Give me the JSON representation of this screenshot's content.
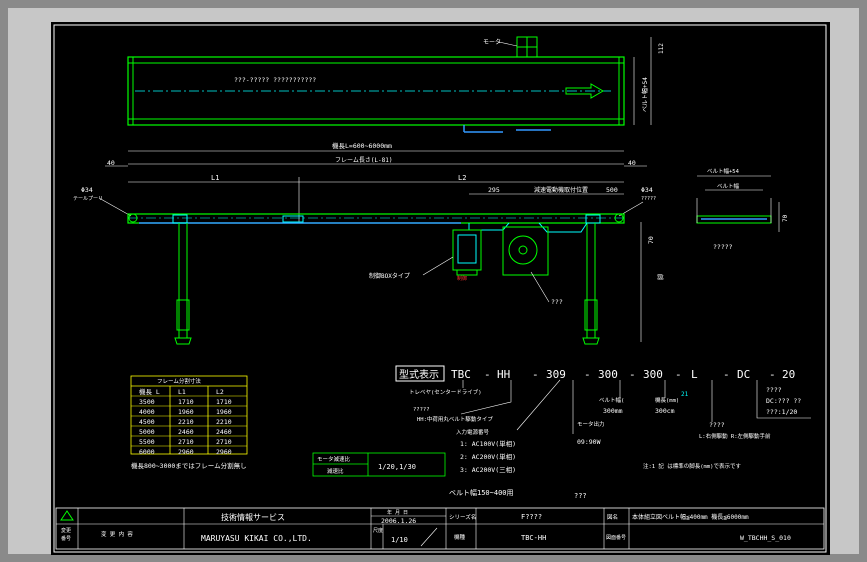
{
  "colors": {
    "background": "#000000",
    "frame": "#ffffff",
    "outline": "#00ff00",
    "dimension": "#ffffff",
    "text": "#ffffff",
    "accent": "#00ffff",
    "highlight": "#ffff00",
    "belt": "#3399ff",
    "label_red": "#ff3333"
  },
  "top_view": {
    "motor_label": "モータ",
    "belt_width_label": "ベルト幅+54",
    "height_dim": "112",
    "centre_text": "???-????? ???????????"
  },
  "side_view": {
    "overall_length": "機長L=600~6000mm",
    "frame_length": "フレーム長さ(L-81)",
    "end_left": "40",
    "end_right": "40",
    "l1": "L1",
    "l2": "L2",
    "dim_295": "295",
    "dim_500": "500",
    "drive_note": "減速電動機取付位置",
    "phi_left": "Φ34",
    "phi_left_label": "テールプーリ",
    "phi_right": "Φ34",
    "phi_right_label": "?????",
    "dim_70": "70",
    "leg_note": "脚",
    "control_box": "制御BOXタイプ",
    "control_box_ref": "制御",
    "motor_ref": "???"
  },
  "section_view": {
    "belt_width_top": "ベルト幅+54",
    "belt_width": "ベルト幅",
    "height": "70",
    "label": "?????"
  },
  "model": {
    "title": "型式表示",
    "code_parts": [
      "TBC",
      "HH",
      "309",
      "300",
      "300",
      "L",
      "DC",
      "20"
    ],
    "separator": "-",
    "n_tbc": "トレベヤ(センタードライブ)",
    "n_hh_q": "?????",
    "n_hh": "HH:中荷用丸ベルト駆動タイプ",
    "n_309_a": "入力電源番号",
    "n_309_1": "1:  AC100V(単相)",
    "n_309_2": "2:  AC200V(単相)",
    "n_309_3": "3:  AC200V(三相)",
    "n_motor": "モータ出力",
    "n_motor_val": "09:90W",
    "n_300a": "ベルト幅(",
    "n_300a_val": "300mm",
    "n_300b": "機長(mm)",
    "n_300b_val": "300cm",
    "n_300b_sup": "21",
    "n_l_q": "????",
    "n_l": "L:右側駆動 R:左側駆動手前",
    "n_dc_q": "????",
    "n_dc_1": "DC:??? ??",
    "n_dc_2": "???:1/20",
    "note": "注:1 記 は標準の脚長(mm)で表示です",
    "belt_range": "ベルト幅150~400用",
    "belt_range_q": "???"
  },
  "frame_table": {
    "title": "フレーム分割寸法",
    "headers": [
      "機長 L",
      "L1",
      "L2"
    ],
    "rows": [
      [
        "3500",
        "1710",
        "1710"
      ],
      [
        "4000",
        "1960",
        "1960"
      ],
      [
        "4500",
        "2210",
        "2210"
      ],
      [
        "5000",
        "2460",
        "2460"
      ],
      [
        "5500",
        "2710",
        "2710"
      ],
      [
        "6000",
        "2960",
        "2960"
      ]
    ],
    "note": "機長800~3000まではフレーム分割無し"
  },
  "motor_table": {
    "label1": "モータ減速比",
    "label2": "減速比",
    "value": "1/20,1/30"
  },
  "title_block": {
    "change_mark": "変更",
    "change_no": "番号",
    "change_content": "変 更 内 容",
    "service": "技術情報サービス",
    "company": "MARUYASU KIKAI CO.,LTD.",
    "date_label": "年 月 日",
    "date": "2006.1.26",
    "scale_label": "尺度",
    "scale": "1/10",
    "series_label": "シリーズ名",
    "series": "F????",
    "model_label": "機種",
    "model": "TBC-HH",
    "drawing_label": "図名",
    "drawing_name": "本体組立図ベルト幅≦400mm 機長≦6000mm",
    "drawing_no_label": "図面番号",
    "drawing_no": "W_TBCHH_S_010"
  }
}
